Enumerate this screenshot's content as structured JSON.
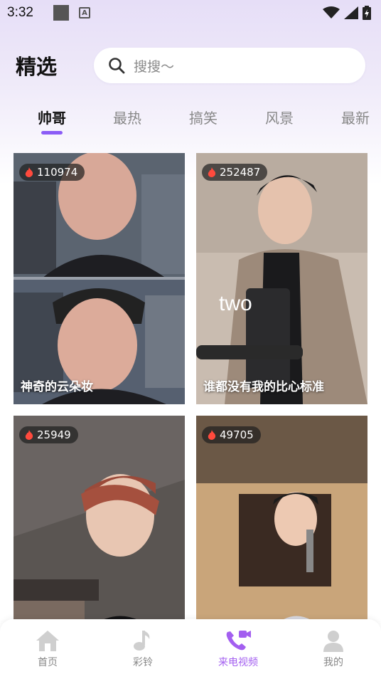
{
  "status_bar": {
    "time": "3:32",
    "a_glyph": "A"
  },
  "header": {
    "title": "精选",
    "search_placeholder": "搜搜～"
  },
  "tabs": [
    {
      "label": "帅哥",
      "active": true
    },
    {
      "label": "最热",
      "active": false
    },
    {
      "label": "搞笑",
      "active": false
    },
    {
      "label": "风景",
      "active": false
    },
    {
      "label": "最新",
      "active": false
    }
  ],
  "videos": [
    {
      "count": "110974",
      "caption": "神奇的云朵妆"
    },
    {
      "count": "252487",
      "caption": "谁都没有我的比心标准"
    },
    {
      "count": "25949",
      "caption": ""
    },
    {
      "count": "49705",
      "caption": ""
    }
  ],
  "thumb_text": "two",
  "nav": [
    {
      "label": "首页",
      "icon": "home-icon",
      "active": false
    },
    {
      "label": "彩铃",
      "icon": "music-note-icon",
      "active": false
    },
    {
      "label": "来电视频",
      "icon": "video-call-icon",
      "active": true
    },
    {
      "label": "我的",
      "icon": "user-icon",
      "active": false
    }
  ],
  "colors": {
    "accent": "#8b5cf6",
    "nav_active": "#a35ff0",
    "fire": "#ff4a3d"
  }
}
